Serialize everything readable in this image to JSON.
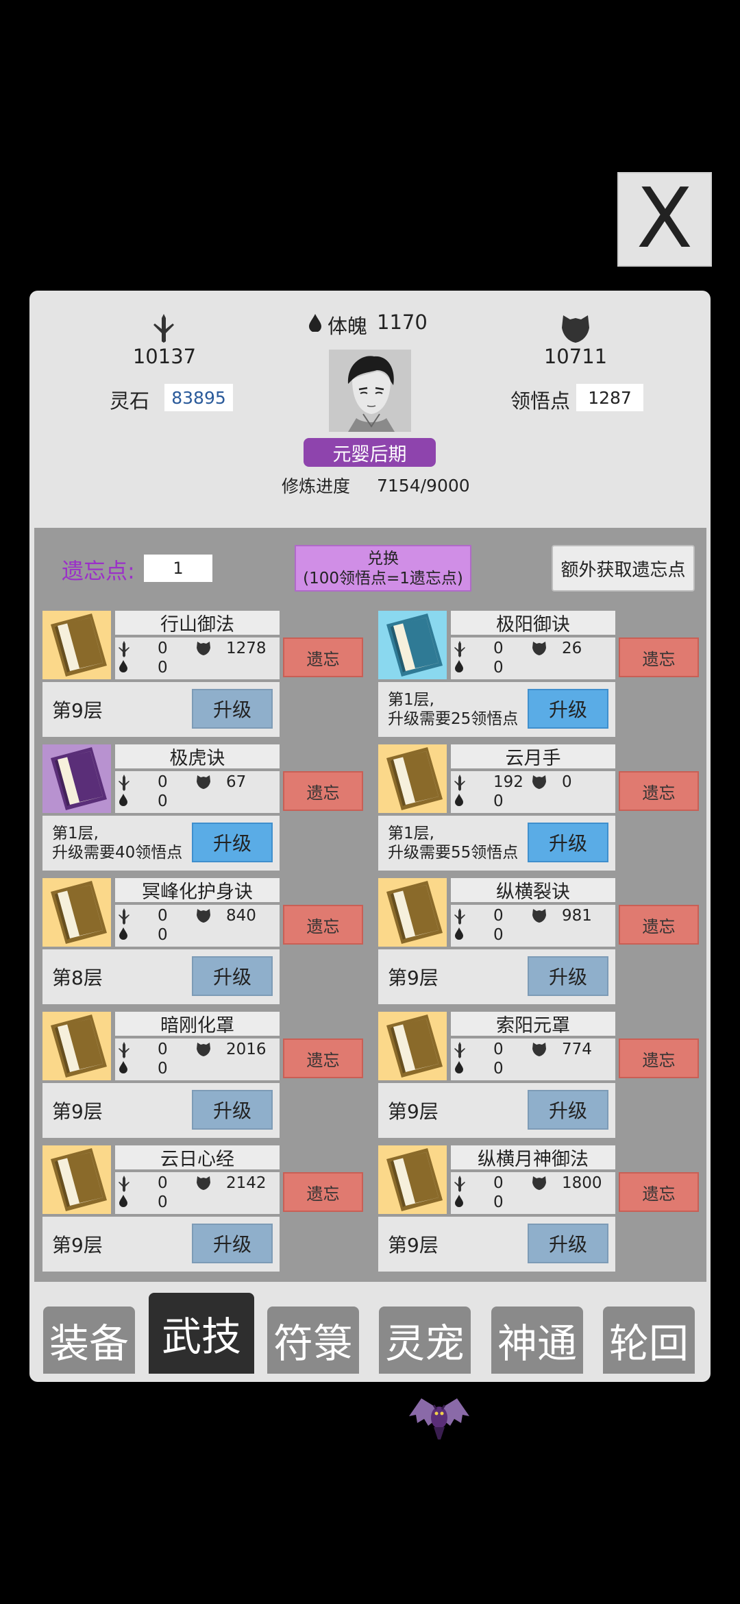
{
  "close_label": "X",
  "header": {
    "attack_value": "10137",
    "defense_value": "10711",
    "body_label": "体魄",
    "body_value": "1170",
    "spirit_stone_label": "灵石",
    "spirit_stone_value": "83895",
    "insight_label": "领悟点",
    "insight_value": "1287",
    "realm": "元婴后期",
    "progress_label": "修炼进度",
    "progress_value": "7154/9000"
  },
  "forget_points": {
    "label": "遗忘点:",
    "value": "1",
    "exchange_line1": "兑换",
    "exchange_line2": "(100领悟点=1遗忘点)",
    "extra_label": "额外获取遗忘点"
  },
  "skills": [
    {
      "name": "行山御法",
      "atk": "0",
      "def": "1278",
      "hp": "0",
      "layer": "第9层",
      "upgrade": "升级",
      "forget": "遗忘",
      "color": "#8a6a2a",
      "bg": "#fbd88a",
      "active": false
    },
    {
      "name": "极阳御诀",
      "atk": "0",
      "def": "26",
      "hp": "0",
      "layer": "第1层,\n升级需要25领悟点",
      "upgrade": "升级",
      "forget": "遗忘",
      "color": "#2f7a95",
      "bg": "#8ad8ef",
      "active": true
    },
    {
      "name": "极虎诀",
      "atk": "0",
      "def": "67",
      "hp": "0",
      "layer": "第1层,\n升级需要40领悟点",
      "upgrade": "升级",
      "forget": "遗忘",
      "color": "#5a2e78",
      "bg": "#b892d0",
      "active": true
    },
    {
      "name": "云月手",
      "atk": "192",
      "def": "0",
      "hp": "0",
      "layer": "第1层,\n升级需要55领悟点",
      "upgrade": "升级",
      "forget": "遗忘",
      "color": "#8a6a2a",
      "bg": "#fbd88a",
      "active": true
    },
    {
      "name": "冥峰化护身诀",
      "atk": "0",
      "def": "840",
      "hp": "0",
      "layer": "第8层",
      "upgrade": "升级",
      "forget": "遗忘",
      "color": "#8a6a2a",
      "bg": "#fbd88a",
      "active": false
    },
    {
      "name": "纵横裂诀",
      "atk": "0",
      "def": "981",
      "hp": "0",
      "layer": "第9层",
      "upgrade": "升级",
      "forget": "遗忘",
      "color": "#8a6a2a",
      "bg": "#fbd88a",
      "active": false
    },
    {
      "name": "暗刚化罩",
      "atk": "0",
      "def": "2016",
      "hp": "0",
      "layer": "第9层",
      "upgrade": "升级",
      "forget": "遗忘",
      "color": "#8a6a2a",
      "bg": "#fbd88a",
      "active": false
    },
    {
      "name": "索阳元罩",
      "atk": "0",
      "def": "774",
      "hp": "0",
      "layer": "第9层",
      "upgrade": "升级",
      "forget": "遗忘",
      "color": "#8a6a2a",
      "bg": "#fbd88a",
      "active": false
    },
    {
      "name": "云日心经",
      "atk": "0",
      "def": "2142",
      "hp": "0",
      "layer": "第9层",
      "upgrade": "升级",
      "forget": "遗忘",
      "color": "#8a6a2a",
      "bg": "#fbd88a",
      "active": false
    },
    {
      "name": "纵横月神御法",
      "atk": "0",
      "def": "1800",
      "hp": "0",
      "layer": "第9层",
      "upgrade": "升级",
      "forget": "遗忘",
      "color": "#8a6a2a",
      "bg": "#fbd88a",
      "active": false
    }
  ],
  "tabs": [
    "装备",
    "武技",
    "符箓",
    "灵宠",
    "神通",
    "轮回"
  ],
  "active_tab": "武技"
}
